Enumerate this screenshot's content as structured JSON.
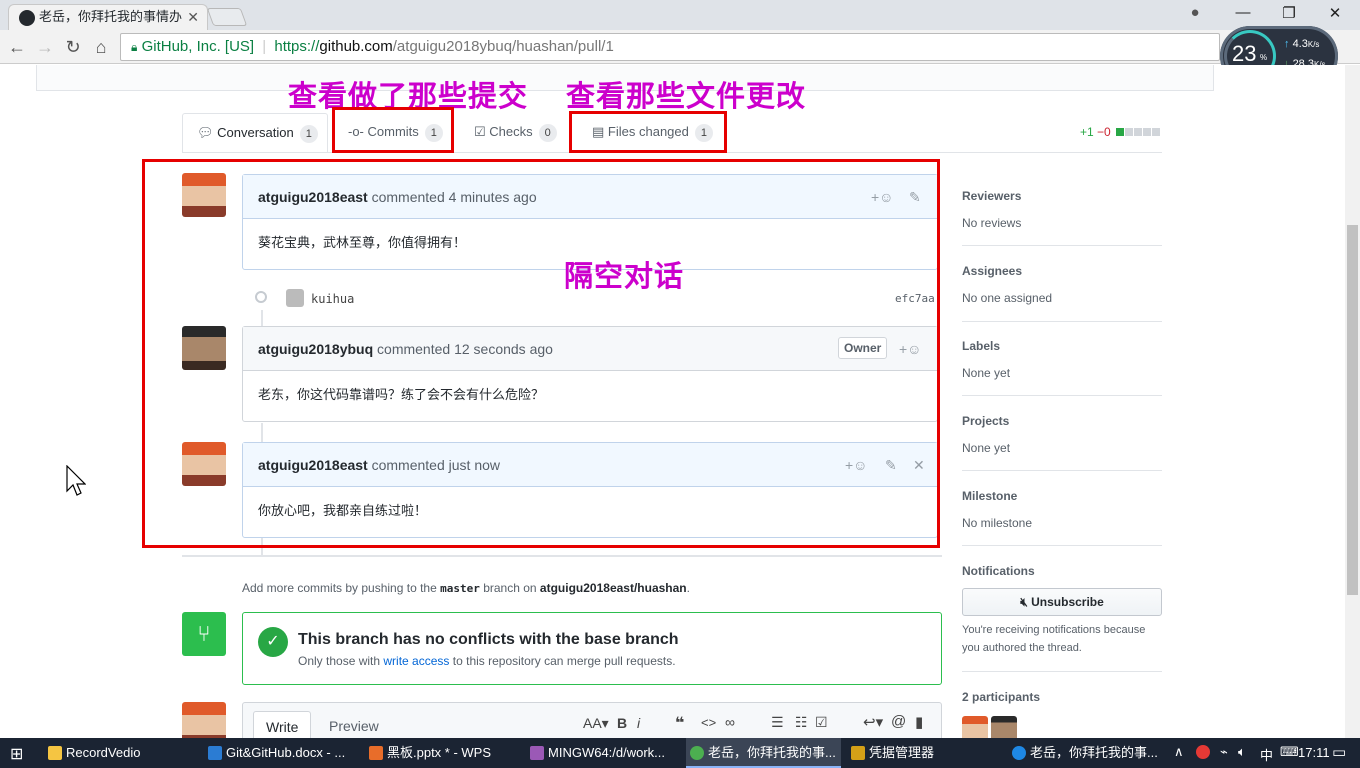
{
  "browser": {
    "tab_title": "老岳，你拜托我的事情办",
    "site_identity": "GitHub, Inc. [US]",
    "url_prefix": "https://",
    "url_host": "github.com",
    "url_path": "/atguigu2018ybuq/huashan/pull/1"
  },
  "speed_widget": {
    "percent": "23",
    "percent_unit": "%",
    "up": "4.3",
    "down": "28.3",
    "unit": "K/s"
  },
  "annotations": {
    "commits_note": "查看做了那些提交",
    "files_note": "查看那些文件更改",
    "conversation_note": "隔空对话"
  },
  "pr_tabs": [
    {
      "label": "Conversation",
      "count": "1"
    },
    {
      "label": "Commits",
      "count": "1"
    },
    {
      "label": "Checks",
      "count": "0"
    },
    {
      "label": "Files changed",
      "count": "1"
    }
  ],
  "diffstat": {
    "added": "+1",
    "removed": "−0"
  },
  "comments": [
    {
      "author": "atguigu2018east",
      "action": "commented",
      "time": "4 minutes ago",
      "body": "葵花宝典，武林至尊，你值得拥有！"
    },
    {
      "author": "atguigu2018ybuq",
      "action": "commented",
      "time": "12 seconds ago",
      "badge": "Owner",
      "body": "老东，你这代码靠谱吗？练了会不会有什么危险？"
    },
    {
      "author": "atguigu2018east",
      "action": "commented",
      "time": "just now",
      "body": "你放心吧，我都亲自练过啦！"
    }
  ],
  "commit_event": {
    "author": "kuihua",
    "sha": "efc7aa"
  },
  "push_hint": {
    "prefix": "Add more commits by pushing to the",
    "branch": "master",
    "middle": "branch on",
    "repo": "atguigu2018east/huashan",
    "suffix": "."
  },
  "merge": {
    "title": "This branch has no conflicts with the base branch",
    "sub_prefix": "Only those with",
    "sub_link": "write access",
    "sub_suffix": "to this repository can merge pull requests."
  },
  "editor": {
    "tab_write": "Write",
    "tab_preview": "Preview"
  },
  "sidebar": {
    "reviewers": {
      "label": "Reviewers",
      "value": "No reviews"
    },
    "assignees": {
      "label": "Assignees",
      "value": "No one assigned"
    },
    "labels": {
      "label": "Labels",
      "value": "None yet"
    },
    "projects": {
      "label": "Projects",
      "value": "None yet"
    },
    "milestone": {
      "label": "Milestone",
      "value": "No milestone"
    },
    "notifications": {
      "label": "Notifications",
      "button": "Unsubscribe",
      "note_line1": "You're receiving notifications because",
      "note_line2": "you authored the thread."
    },
    "participants": {
      "label": "2 participants"
    }
  },
  "taskbar": {
    "items": [
      "RecordVedio",
      "Git&GitHub.docx - ...",
      "黑板.pptx * - WPS",
      "MINGW64:/d/work...",
      "老岳，你拜托我的事...",
      "凭据管理器",
      "老岳，你拜托我的事..."
    ],
    "ime": "中",
    "clock": "17:11"
  },
  "colors": {
    "accent_red": "#e60000",
    "annotation": "#cc00cc",
    "github_green": "#28a745",
    "link_blue": "#0366d6"
  }
}
